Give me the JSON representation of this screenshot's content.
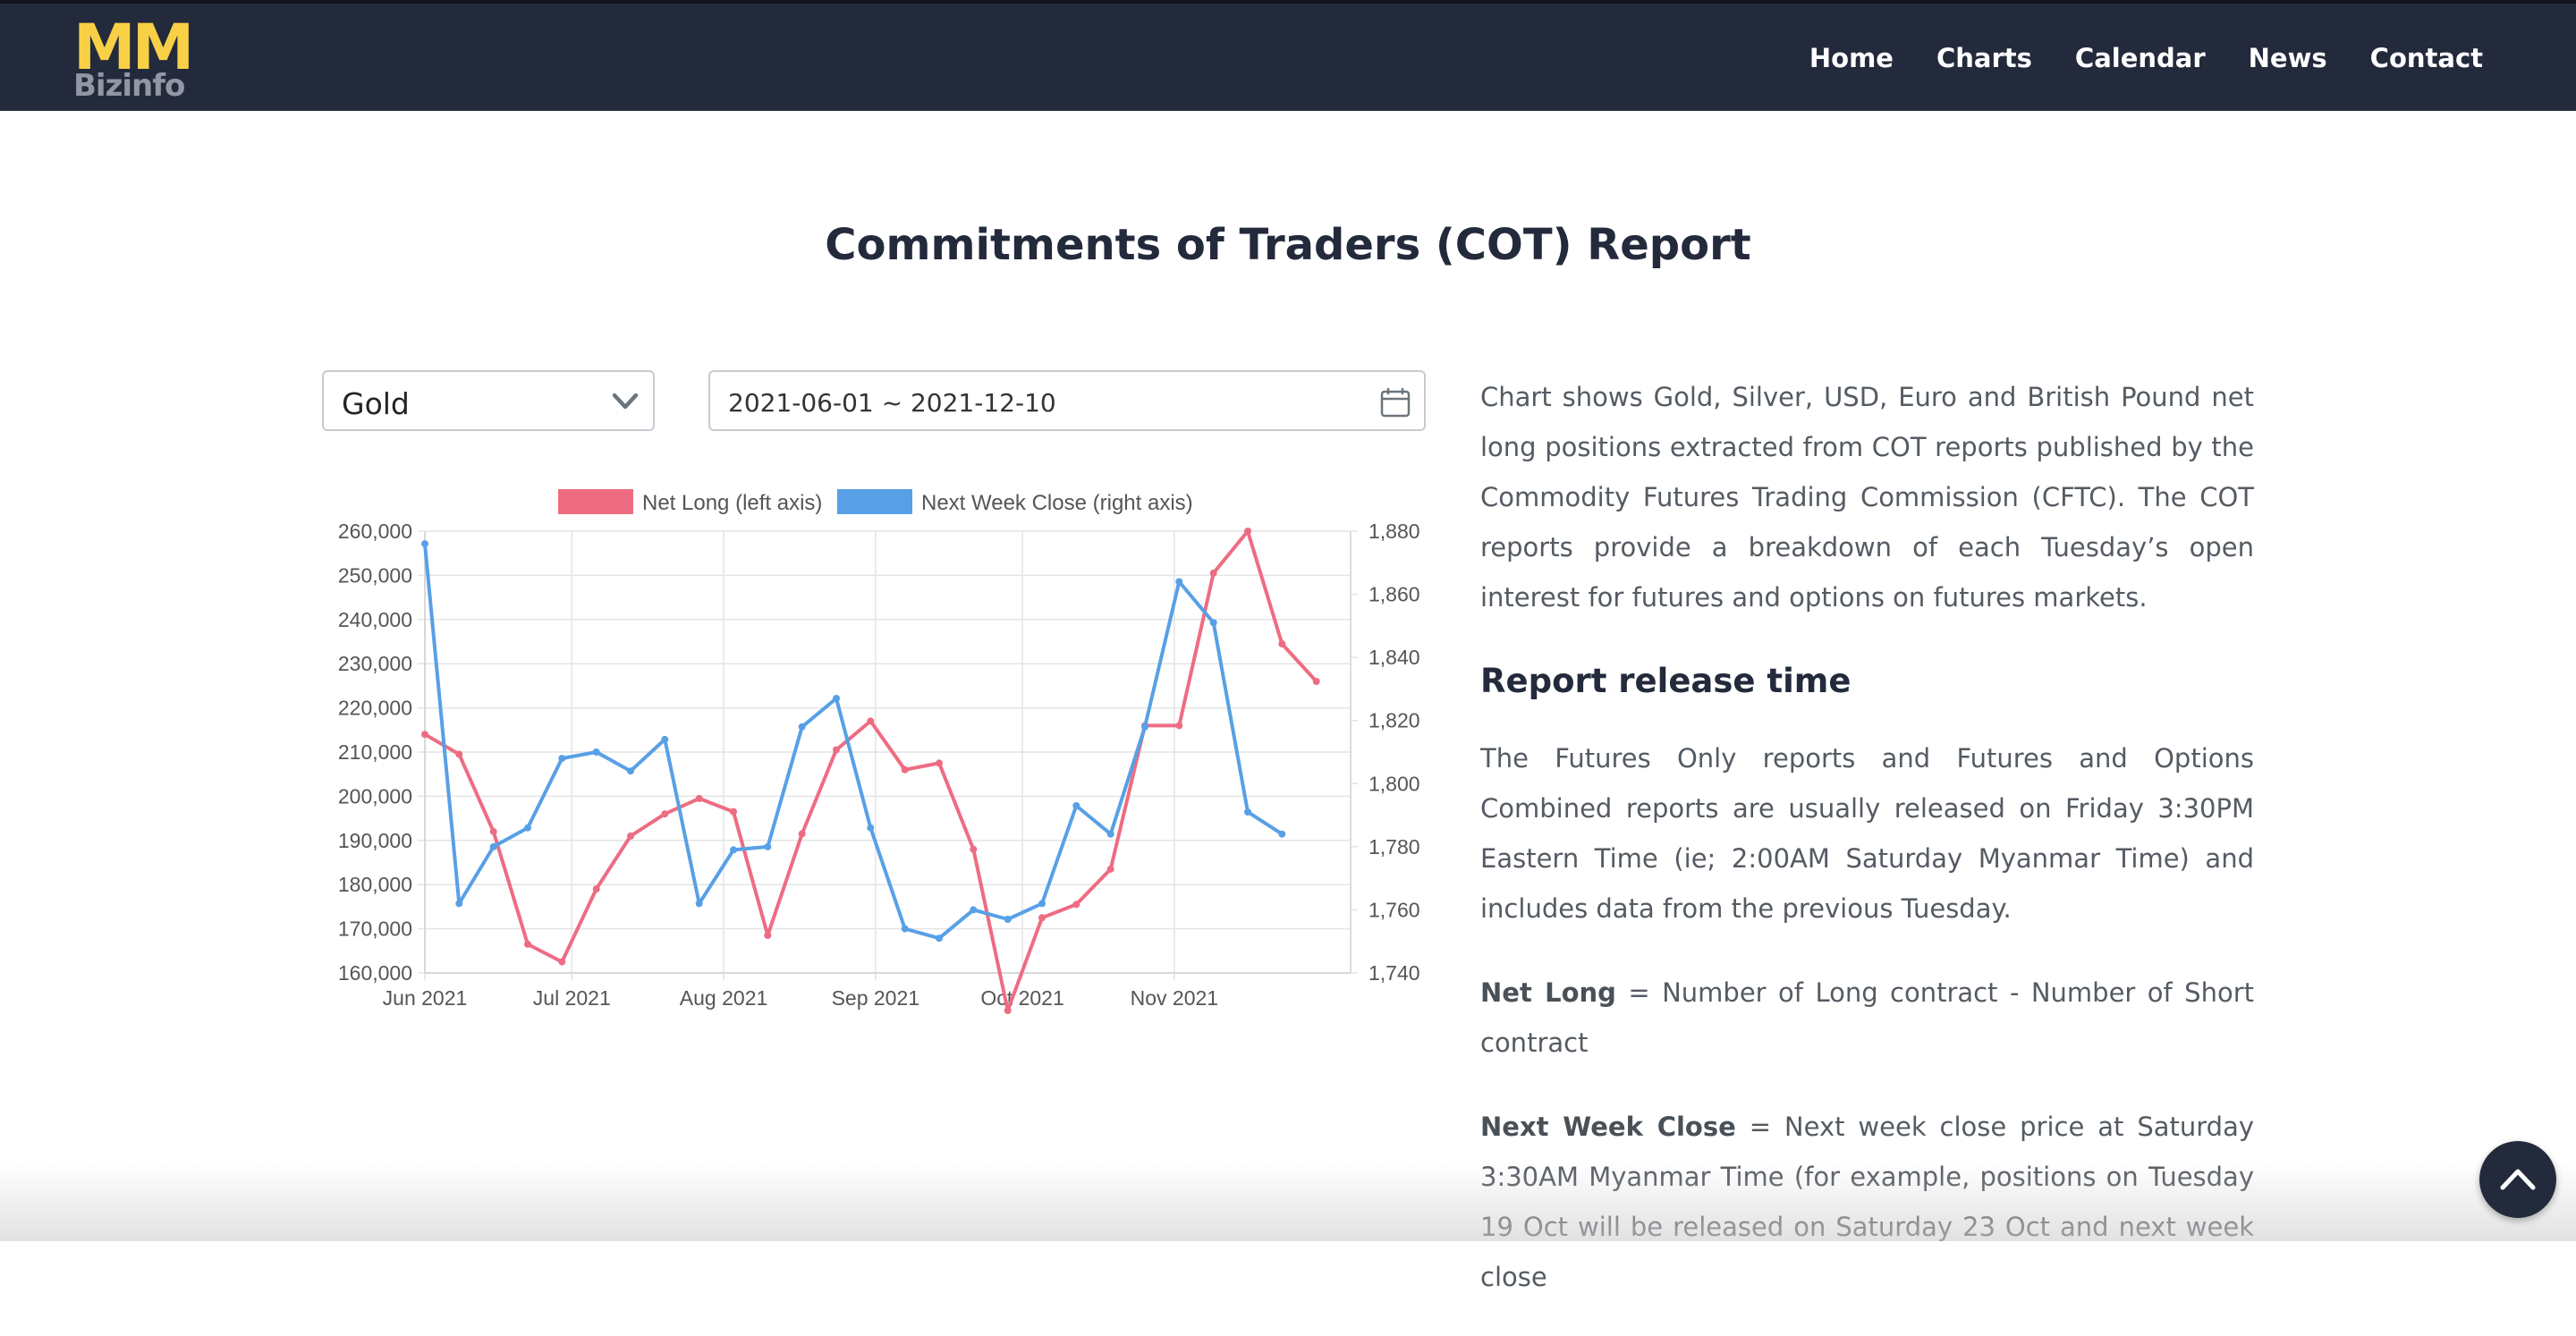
{
  "brand": {
    "logo_main": "MM",
    "logo_sub": "Bizinfo"
  },
  "nav": {
    "items": [
      "Home",
      "Charts",
      "Calendar",
      "News",
      "Contact"
    ]
  },
  "page": {
    "title": "Commitments of Traders (COT) Report"
  },
  "controls": {
    "commodity_value": "Gold",
    "date_range_value": "2021-06-01 ~ 2021-12-10"
  },
  "icons": {
    "select_caret": "chevron-down-icon",
    "date_picker": "calendar-icon",
    "back_to_top": "arrow-up-icon"
  },
  "colors": {
    "navbar": "#232a3b",
    "logo": "#f8d046",
    "net_long": "#ee6c82",
    "next_week_close": "#58a0e6",
    "heading": "#232a3b",
    "body_text": "#555b63"
  },
  "content": {
    "intro": "Chart shows Gold, Silver, USD, Euro and British Pound net long positions extracted from COT reports published by the Commodity Futures Trading Commission (CFTC). The COT reports provide a breakdown of each Tuesday’s open interest for futures and options on futures markets.",
    "release_heading": "Report release time",
    "release_text": "The Futures Only reports and Futures and Options Combined reports are usually released on Friday 3:30PM Eastern Time (ie; 2:00AM Saturday Myanmar Time) and includes data from the previous Tuesday.",
    "net_long_term": "Net Long",
    "net_long_def": " = Number of Long contract - Number of Short contract",
    "nwc_term": "Next Week Close",
    "nwc_def": " = Next week close price at Saturday 3:30AM Myanmar Time (for example, positions on Tuesday 19 Oct will be released on Saturday 23 Oct and next week close"
  },
  "chart_data": {
    "type": "line",
    "x_ticks": [
      "Jun 2021",
      "Jul 2021",
      "Aug 2021",
      "Sep 2021",
      "Oct 2021",
      "Nov 2021"
    ],
    "x": [
      "2021-06-01",
      "2021-06-08",
      "2021-06-15",
      "2021-06-22",
      "2021-06-29",
      "2021-07-06",
      "2021-07-13",
      "2021-07-20",
      "2021-07-27",
      "2021-08-03",
      "2021-08-10",
      "2021-08-17",
      "2021-08-24",
      "2021-08-31",
      "2021-09-07",
      "2021-09-14",
      "2021-09-21",
      "2021-09-28",
      "2021-10-05",
      "2021-10-12",
      "2021-10-19",
      "2021-10-26",
      "2021-11-02",
      "2021-11-09",
      "2021-11-16",
      "2021-11-23",
      "2021-11-30"
    ],
    "series": [
      {
        "name": "Net Long (left axis)",
        "axis": "left",
        "values": [
          214000,
          209500,
          192000,
          166500,
          162500,
          179000,
          191000,
          196000,
          199500,
          196500,
          168500,
          191500,
          210500,
          217000,
          206000,
          207500,
          188000,
          151500,
          172500,
          175500,
          183500,
          216000,
          216000,
          250500,
          260000,
          234500,
          226000
        ]
      },
      {
        "name": "Next Week Close (right axis)",
        "axis": "right",
        "values": [
          1876,
          1762,
          1780,
          1786,
          1808,
          1810,
          1804,
          1814,
          1762,
          1779,
          1780,
          1818,
          1827,
          1786,
          1754,
          1751,
          1760,
          1757,
          1762,
          1793,
          1784,
          1818,
          1864,
          1851,
          1791,
          1784,
          null
        ]
      }
    ],
    "left_axis": {
      "ylim": [
        160000,
        260000
      ],
      "ticks": [
        "260,000",
        "250,000",
        "240,000",
        "230,000",
        "220,000",
        "210,000",
        "200,000",
        "190,000",
        "180,000",
        "170,000",
        "160,000"
      ]
    },
    "right_axis": {
      "ylim": [
        1740,
        1880
      ],
      "ticks": [
        "1,880",
        "1,860",
        "1,840",
        "1,820",
        "1,800",
        "1,780",
        "1,760",
        "1,740"
      ]
    },
    "grid": true,
    "legend_position": "top"
  }
}
